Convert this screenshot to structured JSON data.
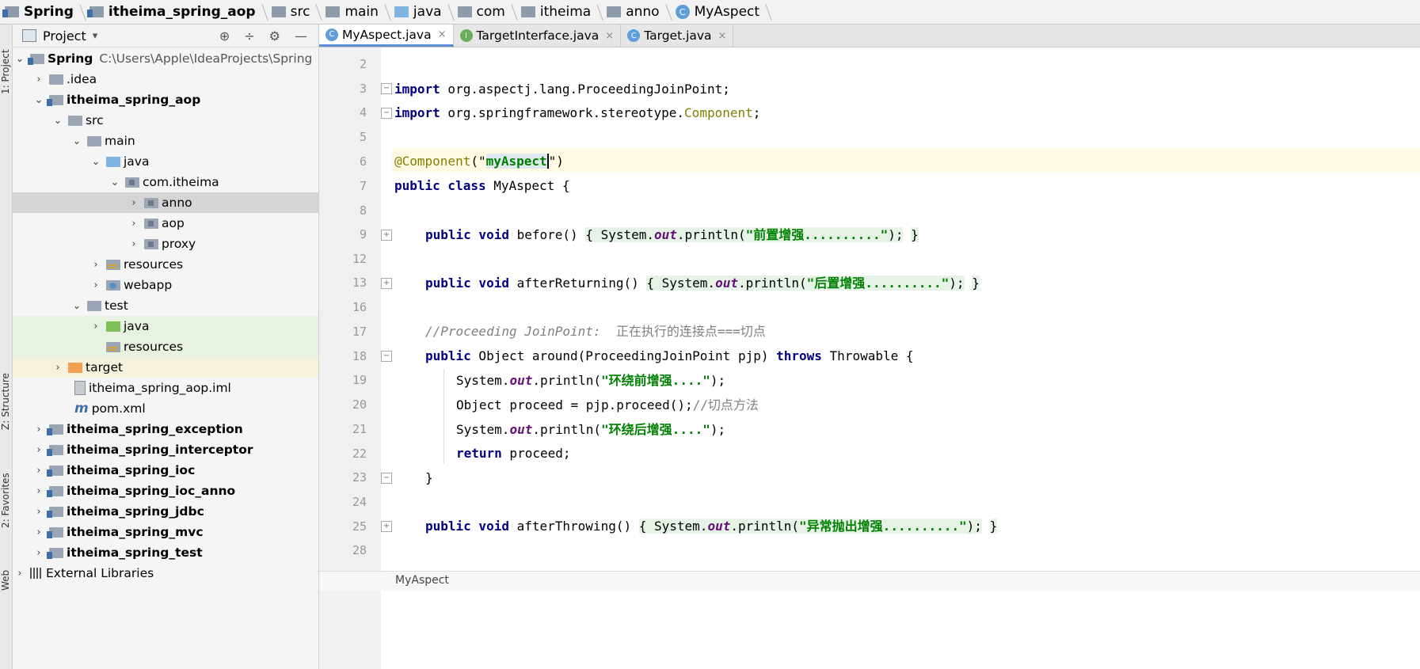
{
  "breadcrumb": [
    "Spring",
    "itheima_spring_aop",
    "src",
    "main",
    "java",
    "com",
    "itheima",
    "anno",
    "MyAspect"
  ],
  "left_strip": {
    "project": "1: Project",
    "structure": "Z: Structure",
    "favorites": "2: Favorites",
    "web": "Web"
  },
  "project_panel": {
    "title": "Project",
    "dropdown": "▾",
    "tools": [
      "⊕",
      "÷",
      "⚙",
      "—"
    ],
    "tree": [
      {
        "label": "Spring",
        "path": "C:\\Users\\Apple\\IdeaProjects\\Spring"
      },
      {
        "label": ".idea"
      },
      {
        "label": "itheima_spring_aop"
      },
      {
        "label": "src"
      },
      {
        "label": "main"
      },
      {
        "label": "java"
      },
      {
        "label": "com.itheima"
      },
      {
        "label": "anno"
      },
      {
        "label": "aop"
      },
      {
        "label": "proxy"
      },
      {
        "label": "resources"
      },
      {
        "label": "webapp"
      },
      {
        "label": "test"
      },
      {
        "label": "java"
      },
      {
        "label": "resources"
      },
      {
        "label": "target"
      },
      {
        "label": "itheima_spring_aop.iml"
      },
      {
        "label": "pom.xml"
      },
      {
        "label": "itheima_spring_exception"
      },
      {
        "label": "itheima_spring_interceptor"
      },
      {
        "label": "itheima_spring_ioc"
      },
      {
        "label": "itheima_spring_ioc_anno"
      },
      {
        "label": "itheima_spring_jdbc"
      },
      {
        "label": "itheima_spring_mvc"
      },
      {
        "label": "itheima_spring_test"
      },
      {
        "label": "External Libraries"
      }
    ]
  },
  "tabs": [
    {
      "label": "MyAspect.java",
      "icon": "C"
    },
    {
      "label": "TargetInterface.java",
      "icon": "I"
    },
    {
      "label": "Target.java",
      "icon": "C"
    }
  ],
  "line_numbers": [
    "2",
    "3",
    "4",
    "5",
    "6",
    "7",
    "8",
    "9",
    "12",
    "13",
    "16",
    "17",
    "18",
    "19",
    "20",
    "21",
    "22",
    "23",
    "24",
    "25",
    "28"
  ],
  "code": {
    "l3_kw": "import",
    "l3_rest": " org.aspectj.lang.ProceedingJoinPoint;",
    "l4_kw": "import",
    "l4_rest": " org.springframework.stereotype.",
    "l4_cls": "Component",
    "l4_end": ";",
    "l6_ann": "@Component",
    "l6_p1": "(\"",
    "l6_str": "myAspect",
    "l6_p2": "\")",
    "l7_kw": "public class",
    "l7_name": " MyAspect {",
    "l9_kw": "public void",
    "l9_name": " before() ",
    "l9_b1": "{",
    "l9_mid1": " System.",
    "l9_out": "out",
    "l9_mid2": ".println(",
    "l9_str": "\"前置增强..........\"",
    "l9_end": ");",
    "l9_b2": "}",
    "l13_kw": "public void",
    "l13_name": " afterReturning() ",
    "l13_b1": "{",
    "l13_mid1": " System.",
    "l13_out": "out",
    "l13_mid2": ".println(",
    "l13_str": "\"后置增强..........\"",
    "l13_end": ");",
    "l13_b2": "}",
    "l17_cm": "//Proceeding JoinPoint:",
    "l17_cmz": "  正在执行的连接点===切点",
    "l18_kw": "public",
    "l18_mid": " Object around(ProceedingJoinPoint pjp) ",
    "l18_kw2": "throws",
    "l18_end": " Throwable {",
    "l19_a": "System.",
    "l19_out": "out",
    "l19_b": ".println(",
    "l19_str": "\"环绕前增强....\"",
    "l19_end": ");",
    "l20_a": "Object proceed = pjp.proceed();",
    "l20_cmz": "//切点方法",
    "l21_a": "System.",
    "l21_out": "out",
    "l21_b": ".println(",
    "l21_str": "\"环绕后增强....\"",
    "l21_end": ");",
    "l22_kw": "return",
    "l22_rest": " proceed;",
    "l23": "}",
    "l25_kw": "public void",
    "l25_name": " afterThrowing() ",
    "l25_b1": "{",
    "l25_mid1": " System.",
    "l25_out": "out",
    "l25_mid2": ".println(",
    "l25_str": "\"异常抛出增强..........\"",
    "l25_end": ");",
    "l25_b2": "}"
  },
  "status_breadcrumb": "MyAspect"
}
